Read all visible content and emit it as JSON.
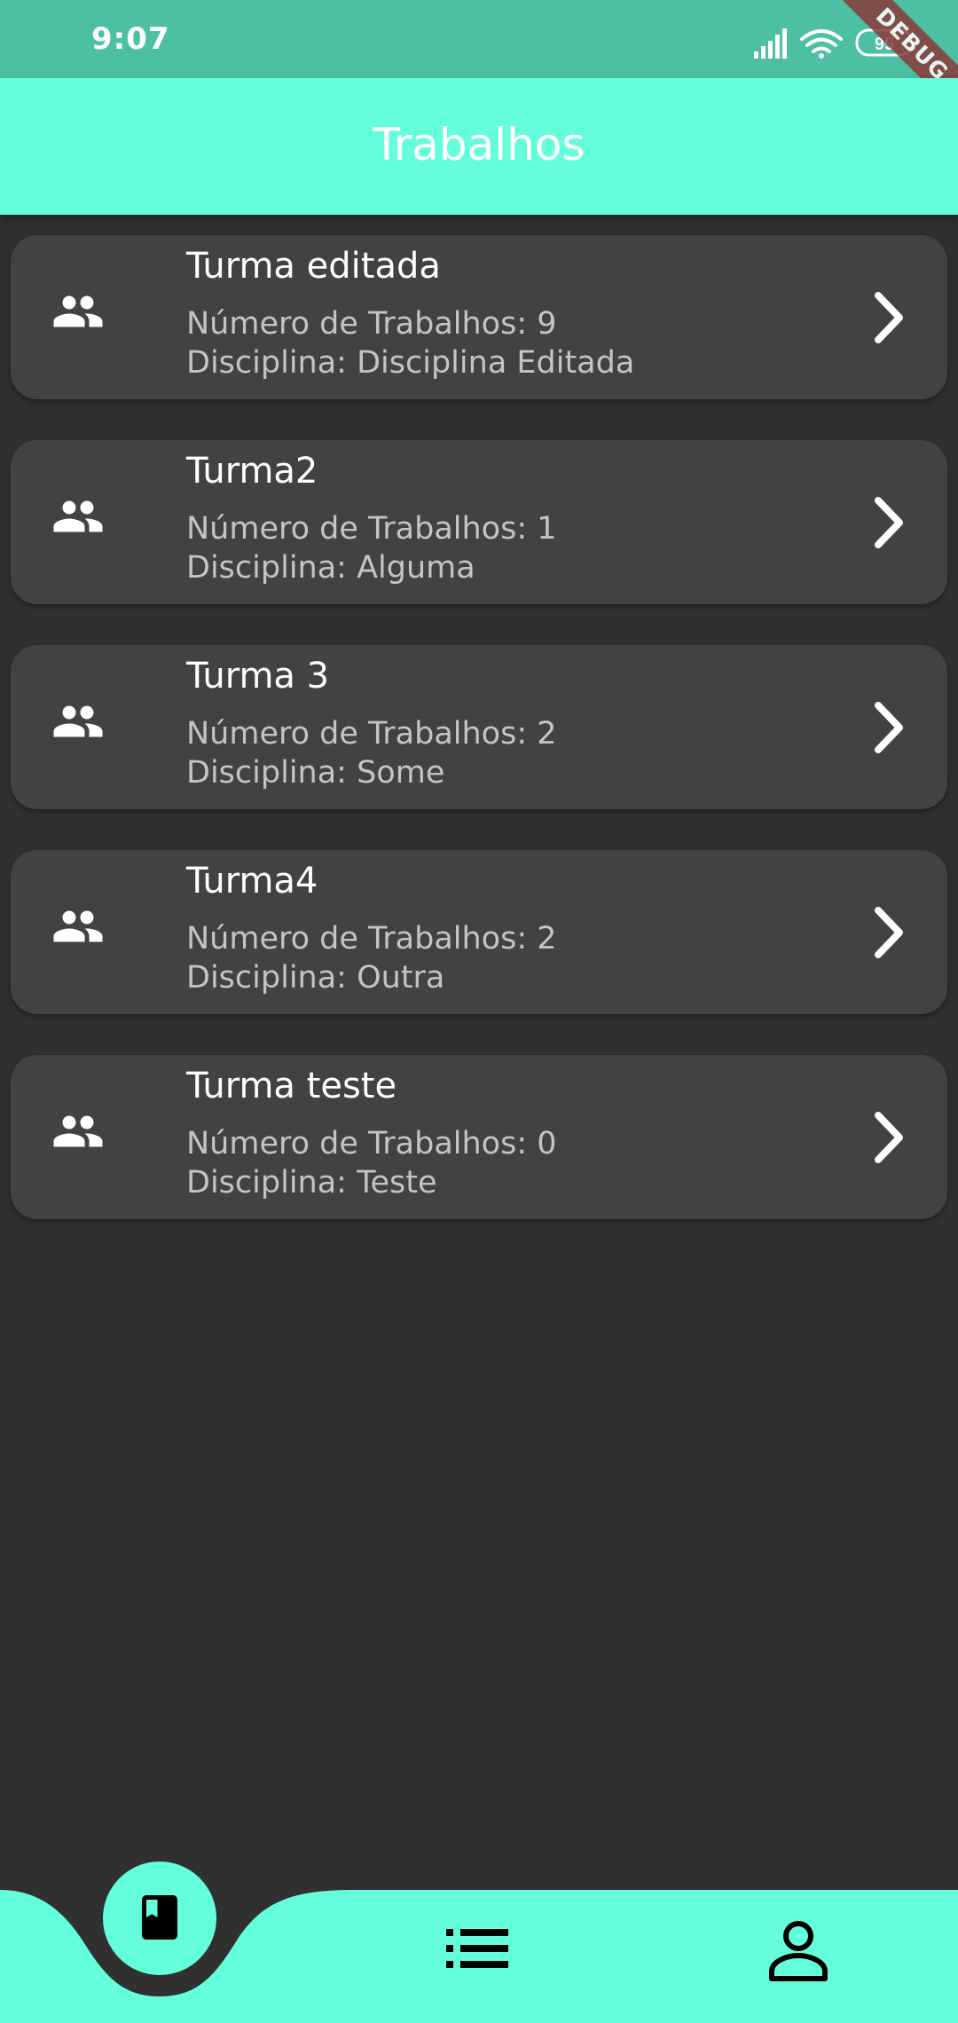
{
  "status_bar": {
    "time": "9:07",
    "battery": "95",
    "debug_label": "DEBUG",
    "background": "#4dbfa4"
  },
  "app_bar": {
    "title": "Trabalhos",
    "background": "#64ffda"
  },
  "cards": [
    {
      "title": "Turma editada",
      "count_line": "Número de Trabalhos: 9",
      "discipline_line": "Disciplina: Disciplina Editada",
      "icon": "people-icon"
    },
    {
      "title": "Turma2",
      "count_line": "Número de Trabalhos: 1",
      "discipline_line": "Disciplina: Alguma",
      "icon": "people-icon"
    },
    {
      "title": "Turma 3",
      "count_line": "Número de Trabalhos: 2",
      "discipline_line": "Disciplina: Some",
      "icon": "people-icon"
    },
    {
      "title": "Turma4",
      "count_line": "Número de Trabalhos: 2",
      "discipline_line": "Disciplina: Outra",
      "icon": "people-icon"
    },
    {
      "title": "Turma teste",
      "count_line": "Número de Trabalhos: 0",
      "discipline_line": "Disciplina: Teste",
      "icon": "people-icon"
    }
  ],
  "bottom_nav": {
    "items": [
      {
        "icon": "book-icon",
        "selected": true
      },
      {
        "icon": "list-icon",
        "selected": false
      },
      {
        "icon": "person-icon",
        "selected": false
      }
    ],
    "background": "#64ffda"
  },
  "colors": {
    "page_background": "#303030",
    "card_background": "#424242",
    "accent": "#64ffda"
  }
}
